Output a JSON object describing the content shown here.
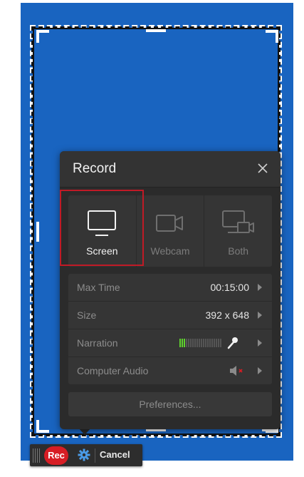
{
  "panel": {
    "title": "Record",
    "close_icon": "close-icon"
  },
  "modes": [
    {
      "label": "Screen",
      "icon": "monitor-icon",
      "selected": true
    },
    {
      "label": "Webcam",
      "icon": "webcam-icon",
      "selected": false
    },
    {
      "label": "Both",
      "icon": "screen-and-webcam-icon",
      "selected": false
    }
  ],
  "settings": {
    "max_time": {
      "label": "Max Time",
      "value": "00:15:00"
    },
    "size": {
      "label": "Size",
      "value": "392 x 648"
    },
    "narration": {
      "label": "Narration",
      "level_fraction": 0.15,
      "icon": "microphone-icon"
    },
    "computer_audio": {
      "label": "Computer Audio",
      "icon": "speaker-muted-icon"
    }
  },
  "preferences_label": "Preferences...",
  "toolbar": {
    "rec_label": "Rec",
    "settings_icon": "gear-icon",
    "cancel_label": "Cancel"
  },
  "colors": {
    "capture_background": "#1964c0",
    "panel_background": "#2b2b2b",
    "selection_outline": "#c01a26",
    "record_red": "#d71d24",
    "meter_green": "#5fd12e",
    "gear_blue": "#4a9be8"
  }
}
